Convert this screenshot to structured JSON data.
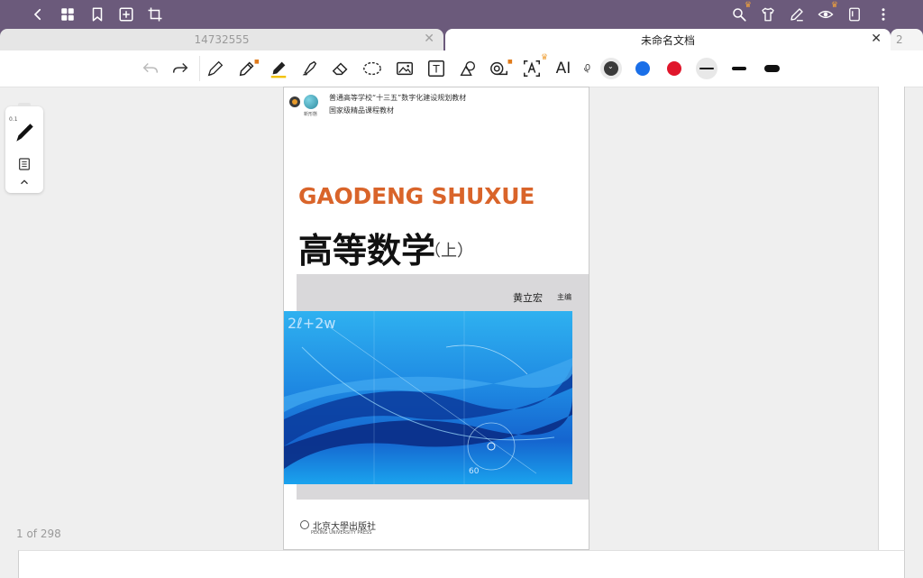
{
  "tabs": [
    {
      "label": "14732555",
      "active": false
    },
    {
      "label": "未命名文档",
      "active": true
    },
    {
      "label": "2",
      "active": false
    }
  ],
  "toolbar": {
    "ai_label": "AI",
    "text_tool_letter": "T",
    "colors": {
      "dark": "#3a3a3a",
      "blue": "#1a6fe8",
      "red": "#e0162b"
    }
  },
  "side_panel": {
    "pen_size": "0.1"
  },
  "page_info": "1 of 298",
  "cover": {
    "series_line1": "普通高等学校“十三五”数字化建设规划教材",
    "series_line2": "国家级精品课程教材",
    "logo_caption": "新形態",
    "romanized_title": "GAODENG SHUXUE",
    "title": "高等数学",
    "volume": "（上）",
    "author": "黄立宏",
    "author_role": "主编",
    "art_formula": "2ℓ+2w",
    "art_number": "60",
    "publisher": "北京大學出版社",
    "publisher_en": "PEKING UNIVERSITY PRESS"
  }
}
